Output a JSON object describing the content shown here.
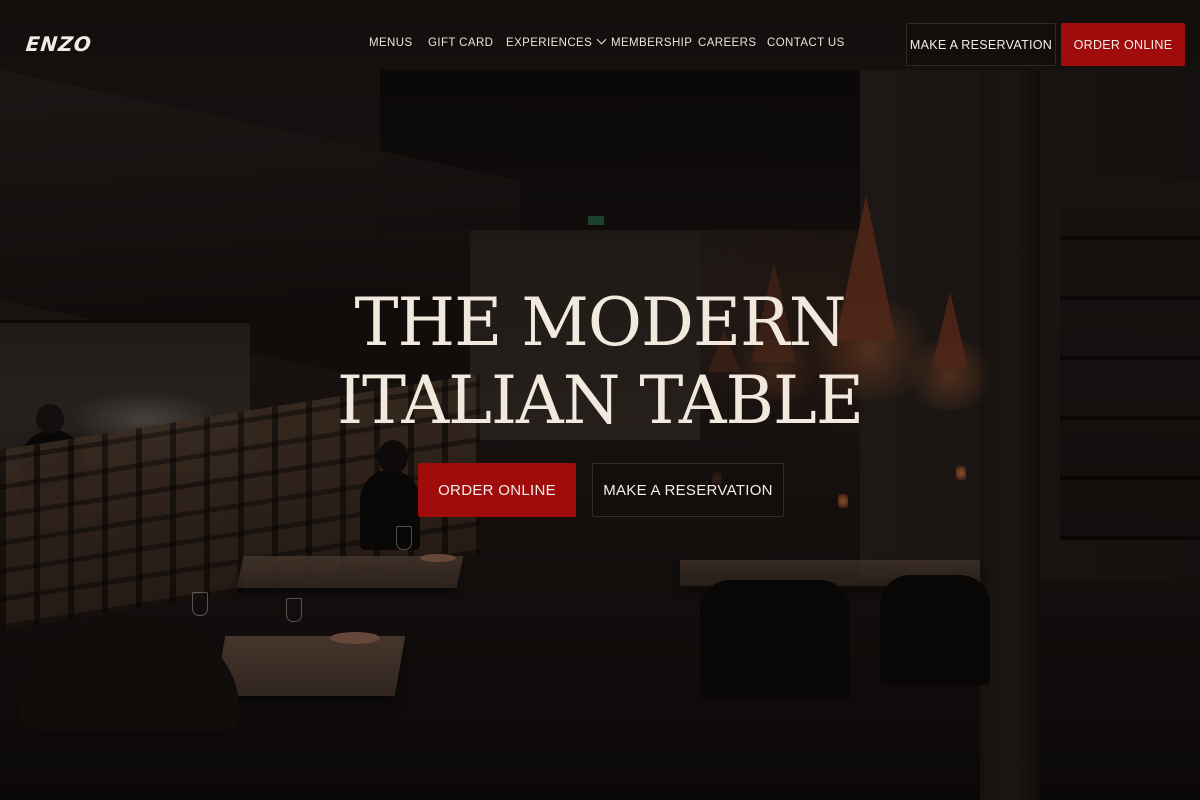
{
  "brand": {
    "logo_text": "ENZO"
  },
  "nav": {
    "items": [
      {
        "label": "MENUS"
      },
      {
        "label": "GIFT CARD"
      },
      {
        "label": "EXPERIENCES",
        "has_dropdown": true
      },
      {
        "label": "MEMBERSHIP"
      },
      {
        "label": "CAREERS"
      },
      {
        "label": "CONTACT US"
      }
    ],
    "dropdown_icon": "chevron-down-icon"
  },
  "header_actions": {
    "reserve_label": "MAKE A RESERVATION",
    "order_label": "ORDER ONLINE"
  },
  "hero": {
    "title_line_1": "THE MODERN",
    "title_line_2": "ITALIAN TABLE",
    "order_label": "ORDER ONLINE",
    "reserve_label": "MAKE A RESERVATION",
    "background": "dimly lit restaurant dining room photo"
  },
  "colors": {
    "accent_red": "#a00c0c",
    "text_light": "#f1e9dd",
    "dark_button": "#120e0c"
  }
}
